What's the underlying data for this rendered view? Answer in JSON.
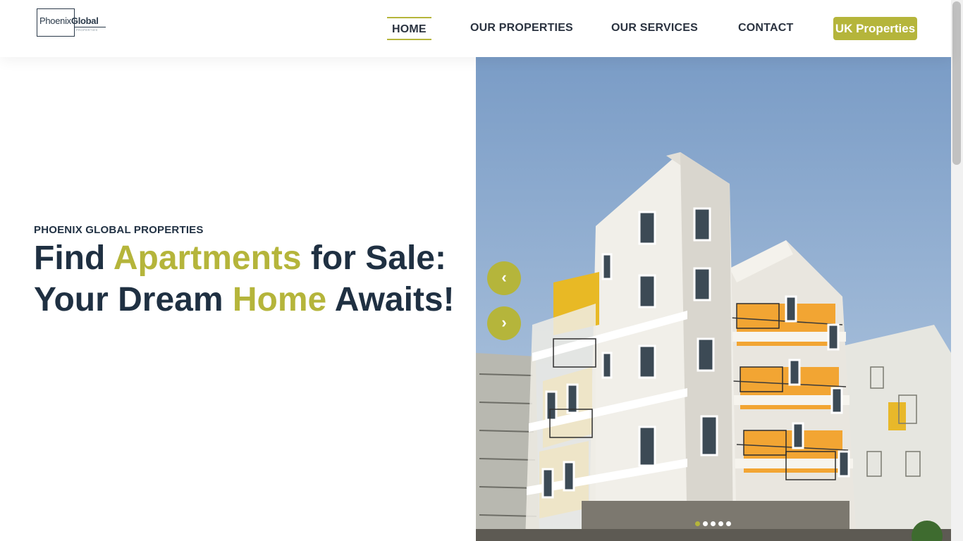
{
  "logo": {
    "text_light": "Phoenix",
    "text_bold": "Global",
    "tagline": "PROPERTIES"
  },
  "nav": {
    "home": "HOME",
    "properties": "OUR PROPERTIES",
    "services": "OUR SERVICES",
    "contact": "CONTACT",
    "uk": "UK Properties"
  },
  "hero": {
    "eyebrow": "PHOENIX GLOBAL PROPERTIES",
    "headline": {
      "part1": "Find ",
      "accent1": "Apartments",
      "part2": " for Sale: Your Dream ",
      "accent2": "Home",
      "part3": " Awaits!"
    },
    "prev_glyph": "‹",
    "next_glyph": "›",
    "slides_count": 5,
    "active_slide": 1
  },
  "colors": {
    "accent": "#b5b53b",
    "heading": "#1f3042",
    "text": "#2b3340"
  }
}
